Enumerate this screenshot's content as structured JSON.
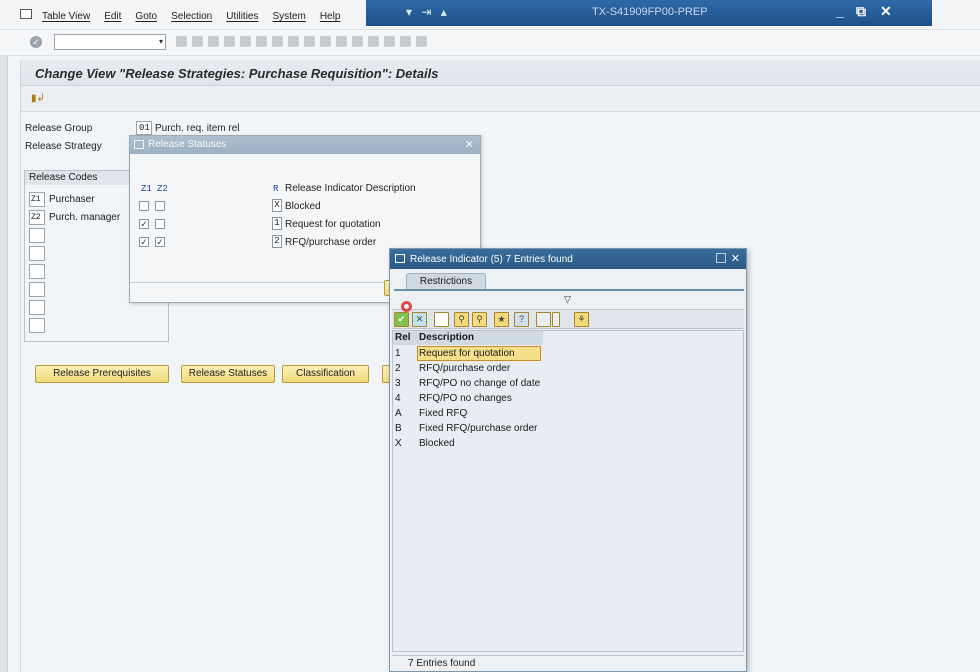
{
  "window": {
    "title": "TX-S41909FP00-PREP",
    "minimize": "_",
    "restore": "⧉",
    "close": "✕",
    "left_glyphs": "▾ ⇥ ▴"
  },
  "menu": {
    "items": [
      "Table View",
      "Edit",
      "Goto",
      "Selection",
      "Utilities",
      "System",
      "Help"
    ]
  },
  "toolbar": {
    "command_value": "",
    "command_arrow": "▾",
    "ok_glyph": "✓"
  },
  "page": {
    "title": "Change View \"Release Strategies: Purchase Requisition\": Details",
    "release_group_label": "Release Group",
    "release_group_code": "01",
    "release_group_text": "Purch. req. item rel",
    "release_strategy_label": "Release Strategy"
  },
  "release_codes": {
    "header": "Release Codes",
    "rows": [
      {
        "code": "Z1",
        "name": "Purchaser"
      },
      {
        "code": "Z2",
        "name": "Purch. manager"
      },
      {
        "code": "",
        "name": ""
      },
      {
        "code": "",
        "name": ""
      },
      {
        "code": "",
        "name": ""
      },
      {
        "code": "",
        "name": ""
      },
      {
        "code": "",
        "name": ""
      },
      {
        "code": "",
        "name": ""
      }
    ]
  },
  "buttons": {
    "prerequisites": "Release Prerequisites",
    "statuses": "Release Statuses",
    "classification": "Classification"
  },
  "statuses_popup": {
    "title": "Release Statuses",
    "close": "✕",
    "col_z1": "Z1",
    "col_z2": "Z2",
    "col_r": "R",
    "col_desc": "Release Indicator Description",
    "rows": [
      {
        "z1": false,
        "z2": false,
        "ind": "X",
        "desc": "Blocked"
      },
      {
        "z1": true,
        "z2": false,
        "ind": "1",
        "desc": "Request for quotation"
      },
      {
        "z1": true,
        "z2": true,
        "ind": "2",
        "desc": "RFQ/purchase order"
      }
    ]
  },
  "indicator_popup": {
    "title": "Release Indicator (5)   7 Entries found",
    "close": "✕",
    "tab_label": "Restrictions",
    "sort_glyph": "▽",
    "col_rel": "Rel",
    "col_desc": "Description",
    "rows": [
      {
        "rel": "1",
        "desc": "Request for quotation",
        "selected": true
      },
      {
        "rel": "2",
        "desc": "RFQ/purchase order",
        "selected": false
      },
      {
        "rel": "3",
        "desc": "RFQ/PO no change of date",
        "selected": false
      },
      {
        "rel": "4",
        "desc": "RFQ/PO no changes",
        "selected": false
      },
      {
        "rel": "A",
        "desc": "Fixed RFQ",
        "selected": false
      },
      {
        "rel": "B",
        "desc": "Fixed RFQ/purchase order",
        "selected": false
      },
      {
        "rel": "X",
        "desc": "Blocked",
        "selected": false
      }
    ],
    "footer": "7 Entries found",
    "icons": [
      "check-icon",
      "delete-icon",
      "new-icon",
      "find-icon",
      "find-next-icon",
      "favorites-icon",
      "help-icon",
      "print-icon",
      "dropdown-icon",
      "tree-icon"
    ]
  },
  "colors": {
    "title_bar": "#2a5883",
    "button_yellow": "#f0db7c",
    "selected_row": "#f6df8a"
  }
}
